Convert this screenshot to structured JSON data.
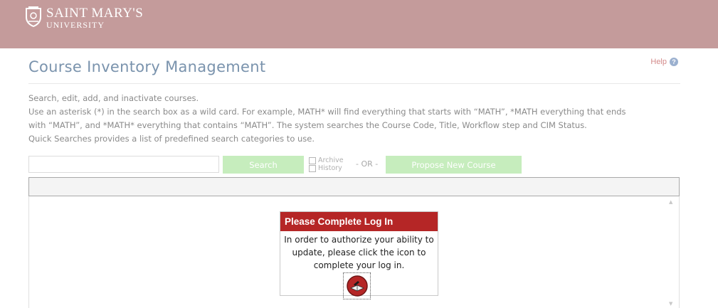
{
  "header": {
    "logo_line1": "SAINT MARY'S",
    "logo_line2": "UNIVERSITY",
    "color": "#c49b9b"
  },
  "help": {
    "label": "Help",
    "icon": "question-circle-icon"
  },
  "page_title": "Course Inventory Management",
  "description": [
    "Search, edit, add, and inactivate courses.",
    "Use an asterisk (*) in the search box as a wild card. For example, MATH* will find everything that starts with “MATH”, *MATH everything that ends",
    "with “MATH”, and *MATH* everything that contains “MATH”. The system searches the Course Code, Title, Workflow step and CIM Status.",
    "Quick Searches provides a list of predefined search categories to use."
  ],
  "search": {
    "value": "",
    "button_label": "Search",
    "button_color": "#c6edbd"
  },
  "archive_option": {
    "line1": "Archive",
    "line2": "History",
    "checked": false
  },
  "or_label": "- OR -",
  "propose_button_label": "Propose New Course",
  "login_dialog": {
    "title": "Please Complete Log In",
    "message_lines": [
      "In order to authorize your ability to",
      "update, please click the icon to",
      "complete your log in."
    ],
    "icon": "login-book-icon",
    "header_color": "#b52626"
  }
}
